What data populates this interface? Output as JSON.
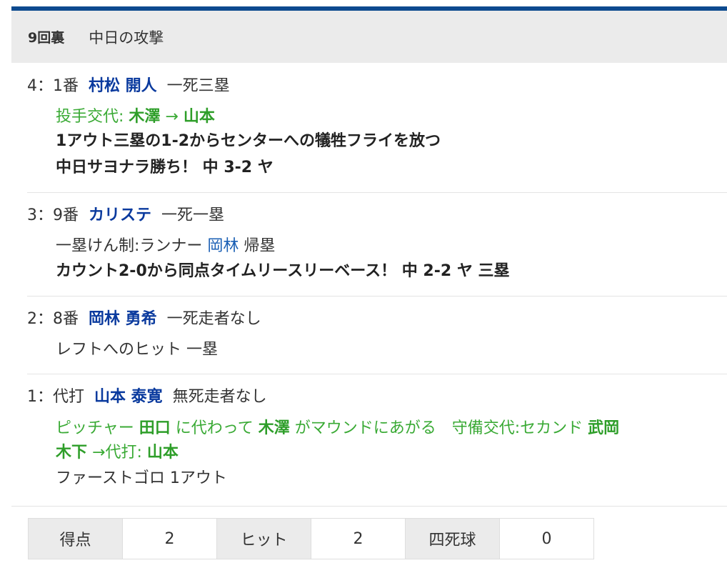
{
  "inning": {
    "label": "9回裏",
    "team": "中日の攻撃"
  },
  "plays": [
    {
      "number": "4：1番",
      "player": "村松 開人",
      "situation": "一死三塁",
      "change_prefix": "投手交代: ",
      "change_from": "木澤",
      "change_arrow": " → ",
      "change_to": "山本",
      "result_line1": "1アウト三塁の1-2からセンターへの犠牲フライを放つ",
      "result_line2": "中日サヨナラ勝ち！ 中 3-2 ヤ"
    },
    {
      "number": "3：9番",
      "player": "カリステ",
      "situation": "一死一塁",
      "note_prefix": "一塁けん制:ランナー ",
      "note_name": "岡林",
      "note_suffix": " 帰塁",
      "result_line1": "カウント2-0から同点タイムリースリーベース！ 中 2-2 ヤ 三塁"
    },
    {
      "number": "2：8番",
      "player": "岡林 勇希",
      "situation": "一死走者なし",
      "result_line1": "レフトへのヒット 一塁"
    },
    {
      "number": "1：代打",
      "player": "山本 泰寛",
      "situation": "無死走者なし",
      "sub_t1": "ピッチャー ",
      "sub_b1": "田口",
      "sub_t2": " に代わって ",
      "sub_b2": "木澤",
      "sub_t3": " がマウンドにあがる　守備交代:セカンド ",
      "sub_b3": "武岡",
      "sub_b4": "木下",
      "sub_t4": " →代打: ",
      "sub_b5": "山本",
      "result_line1": "ファーストゴロ 1アウト"
    }
  ],
  "stats": [
    {
      "label": "得点",
      "value": "2"
    },
    {
      "label": "ヒット",
      "value": "2"
    },
    {
      "label": "四死球",
      "value": "0"
    }
  ]
}
